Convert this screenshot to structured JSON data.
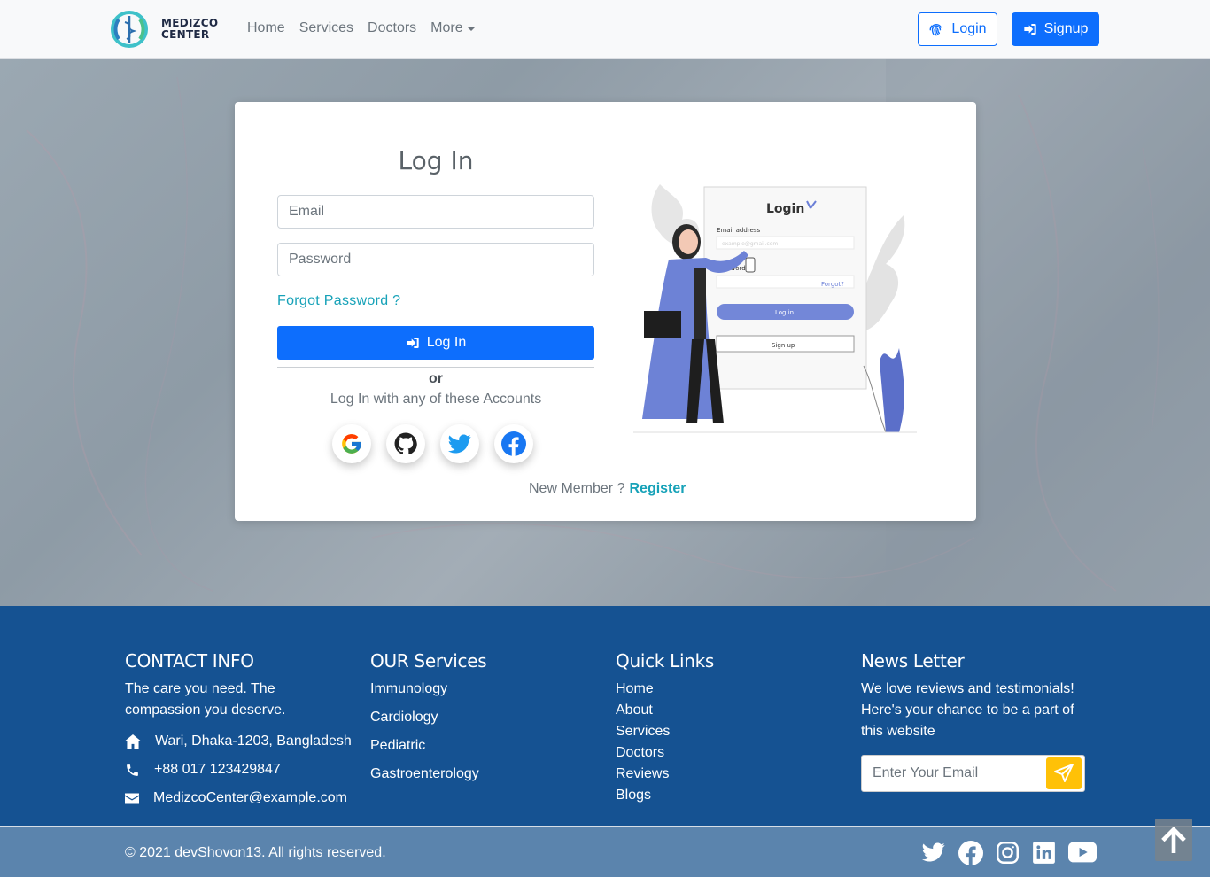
{
  "brand": {
    "line1": "MEDIZCO",
    "line2": "CENTER"
  },
  "nav": {
    "items": [
      {
        "label": "Home"
      },
      {
        "label": "Services"
      },
      {
        "label": "Doctors"
      }
    ],
    "more_label": "More",
    "login_label": "Login",
    "signup_label": "Signup"
  },
  "login": {
    "title": "Log In",
    "email_placeholder": "Email",
    "password_placeholder": "Password",
    "forgot_label": "Forgot Password ?",
    "submit_label": "Log In",
    "or_text": "or",
    "alt_text": "Log In with any of these Accounts",
    "providers": [
      "google-icon",
      "github-icon",
      "twitter-icon",
      "facebook-icon"
    ],
    "new_member_text": "New Member ?",
    "register_label": "Register"
  },
  "illustration": {
    "title": "Login",
    "email_label": "Email address",
    "email_placeholder": "example@gmail.com",
    "password_label": "Password",
    "forgot_label": "Forgot?",
    "login_button": "Log in",
    "signup_button": "Sign up"
  },
  "footer": {
    "contact": {
      "heading": "CONTACT INFO",
      "tagline_1": "The care you need. The",
      "tagline_2": "compassion you deserve.",
      "address": "Wari, Dhaka-1203, Bangladesh",
      "phone": "+88 017 123429847",
      "email": "MedizcoCenter@example.com"
    },
    "services": {
      "heading": "OUR Services",
      "items": [
        "Immunology",
        "Cardiology",
        "Pediatric",
        "Gastroenterology"
      ]
    },
    "quick_links": {
      "heading": "Quick Links",
      "items": [
        "Home",
        "About",
        "Services",
        "Doctors",
        "Reviews",
        "Blogs"
      ]
    },
    "newsletter": {
      "heading": "News Letter",
      "line_1": "We love reviews and testimonials!",
      "line_2": "Here's your chance to be a part of",
      "line_3": "this website",
      "placeholder": "Enter Your Email"
    },
    "copyright": "© 2021 devShovon13. All rights reserved.",
    "social": [
      "twitter-icon",
      "facebook-icon",
      "instagram-icon",
      "linkedin-icon",
      "youtube-icon"
    ]
  },
  "colors": {
    "primary": "#0d6efd",
    "info": "#17a2b8",
    "footer_bg": "#155292",
    "bottom_bar": "#5b84ad",
    "warning": "#ffc107"
  }
}
